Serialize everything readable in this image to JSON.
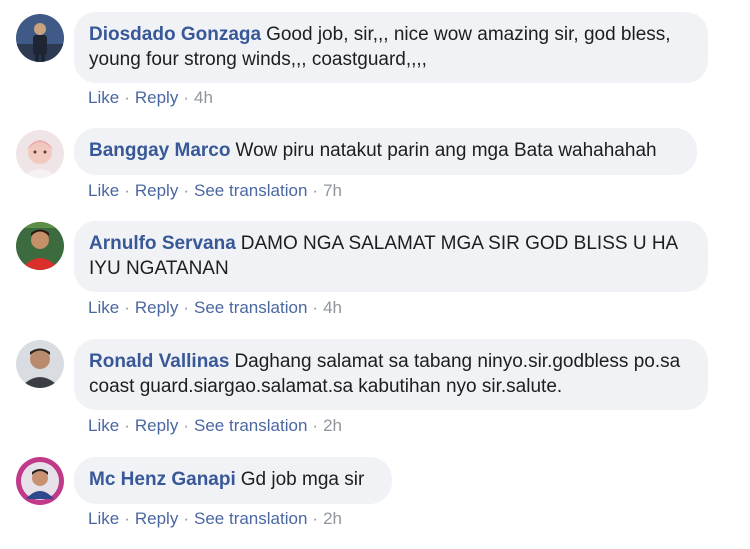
{
  "comments": [
    {
      "author": "Diosdado Gonzaga",
      "text": "Good job, sir,,, nice wow amazing sir, god bless, young four strong winds,,, coastguard,,,,",
      "actions": {
        "like": "Like",
        "reply": "Reply",
        "time": "4h"
      }
    },
    {
      "author": "Banggay Marco",
      "text": "Wow piru natakut parin ang mga Bata wahahahah",
      "actions": {
        "like": "Like",
        "reply": "Reply",
        "translate": "See translation",
        "time": "7h"
      }
    },
    {
      "author": "Arnulfo Servana",
      "text": "DAMO NGA SALAMAT MGA SIR GOD BLISS U HA IYU NGATANAN",
      "actions": {
        "like": "Like",
        "reply": "Reply",
        "translate": "See translation",
        "time": "4h"
      }
    },
    {
      "author": "Ronald Vallinas",
      "text": "Daghang salamat sa tabang ninyo.sir.godbless po.sa coast guard.siargao.salamat.sa kabutihan nyo sir.salute.",
      "actions": {
        "like": "Like",
        "reply": "Reply",
        "translate": "See translation",
        "time": "2h"
      }
    },
    {
      "author": "Mc Henz Ganapi",
      "text": "Gd job mga sir",
      "actions": {
        "like": "Like",
        "reply": "Reply",
        "translate": "See translation",
        "time": "2h"
      }
    }
  ],
  "separator": "·"
}
